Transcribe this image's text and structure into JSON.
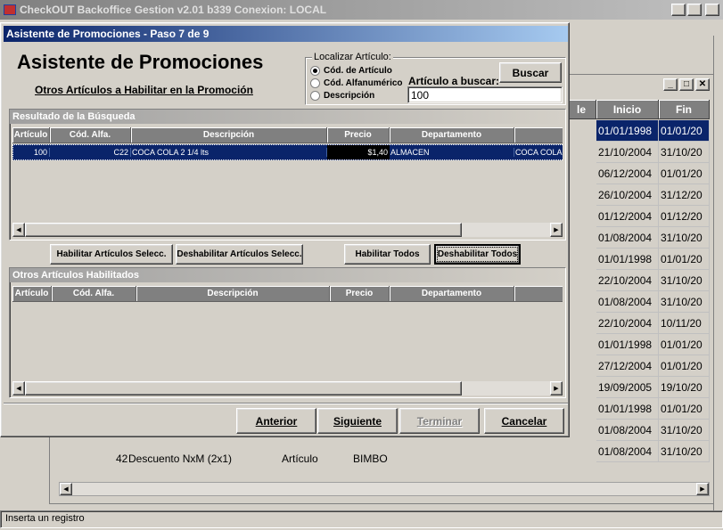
{
  "app": {
    "title": "CheckOUT Backoffice Gestion v2.01 b339 Conexion: LOCAL",
    "statusbar": "Inserta un registro"
  },
  "bgwin": {
    "columns": [
      "le",
      "Inicio",
      "Fin"
    ],
    "rows": [
      {
        "start": "01/01/1998",
        "end": "01/01/20"
      },
      {
        "start": "21/10/2004",
        "end": "31/10/20"
      },
      {
        "start": "06/12/2004",
        "end": "01/01/20"
      },
      {
        "start": "26/10/2004",
        "end": "31/12/20"
      },
      {
        "start": "01/12/2004",
        "end": "01/12/20"
      },
      {
        "start": "01/08/2004",
        "end": "31/10/20"
      },
      {
        "start": "01/01/1998",
        "end": "01/01/20"
      },
      {
        "start": "22/10/2004",
        "end": "31/10/20"
      },
      {
        "start": "01/08/2004",
        "end": "31/10/20"
      },
      {
        "start": "22/10/2004",
        "end": "10/11/20"
      },
      {
        "start": "01/01/1998",
        "end": "01/01/20"
      },
      {
        "start": "27/12/2004",
        "end": "01/01/20"
      },
      {
        "start": "19/09/2005",
        "end": "19/10/20"
      },
      {
        "start": "01/01/1998",
        "end": "01/01/20"
      },
      {
        "start": "01/08/2004",
        "end": "31/10/20"
      },
      {
        "start": "01/08/2004",
        "end": "31/10/20"
      }
    ],
    "partial_row": {
      "num": "42",
      "desc": "Descuento NxM (2x1)",
      "type": "Artículo",
      "dept": "BIMBO"
    }
  },
  "dialog": {
    "title": "Asistente de Promociones - Paso 7 de 9",
    "heading": "Asistente de Promociones",
    "subheading": "Otros Artículos a Habilitar en la Promoción",
    "locate": {
      "legend": "Localizar Artículo:",
      "options": [
        "Cód. de Artículo",
        "Cód. Alfanumérico",
        "Descripción"
      ],
      "search_label": "Artículo a buscar:",
      "search_value": "100",
      "search_button": "Buscar"
    },
    "results": {
      "title": "Resultado de la Búsqueda",
      "columns": [
        "Artículo",
        "Cód. Alfa.",
        "Descripción",
        "Precio",
        "Departamento"
      ],
      "rows": [
        {
          "articulo": "100",
          "alfa": "C22",
          "descripcion": "COCA COLA 2 1/4 lts",
          "precio": "$1,40",
          "departamento": "ALMACEN",
          "extra": "COCA COLA"
        }
      ]
    },
    "buttons": {
      "enable_selected": "Habilitar Artículos Selecc.",
      "disable_selected": "Deshabilitar Artículos Selecc.",
      "enable_all": "Habilitar Todos",
      "disable_all": "Deshabilitar Todos"
    },
    "enabled": {
      "title": "Otros Artículos Habilitados",
      "columns": [
        "Artículo",
        "Cód. Alfa.",
        "Descripción",
        "Precio",
        "Departamento"
      ]
    },
    "nav": {
      "prev": "Anterior",
      "next": "Siguiente",
      "finish": "Terminar",
      "cancel": "Cancelar"
    }
  }
}
